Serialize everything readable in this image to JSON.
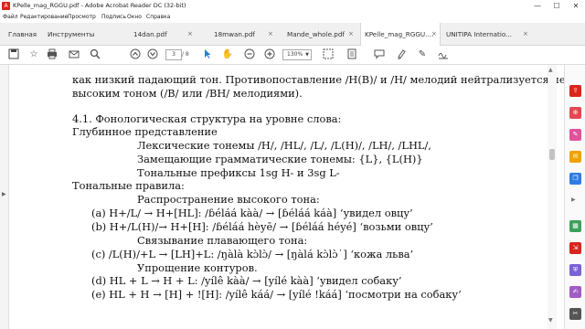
{
  "window": {
    "title": "KPelle_mag_RGGU.pdf - Adobe Acrobat Reader DC (32-bit)",
    "app_icon_glyph": "A",
    "controls": {
      "minimize": "—",
      "maximize": "☐",
      "close": "✕"
    }
  },
  "menu": [
    "Файл",
    "Редактирование",
    "Просмотр",
    "Подпись",
    "Окно",
    "Справка"
  ],
  "tabs": {
    "home": "Главная",
    "tools": "Инструменты",
    "documents": [
      "14dan.pdf",
      "18mwan.pdf",
      "Mande_whole.pdf",
      "KPelle_mag_RGGU....",
      "UNITIPA Internatio..."
    ],
    "active_index": 3,
    "close_glyph": "×"
  },
  "toolbar": {
    "page_current": "3",
    "page_total": "/ 8",
    "zoom": "130%",
    "icons": [
      "save-icon",
      "bookmark-icon",
      "print-icon",
      "email-icon",
      "search-icon",
      "page-up-icon",
      "page-down-icon",
      "select-cursor-icon",
      "hand-icon",
      "zoom-out-icon",
      "zoom-in-icon",
      "marquee-zoom-icon",
      "fit-page-icon",
      "comment-icon",
      "highlight-icon",
      "draw-icon",
      "sign-icon"
    ]
  },
  "document": {
    "lines": [
      "как низкий падающий тон. Противопоставление /H(B)/ и /H/ мелодий нейтрализуется перед",
      "высоким тоном (/B/ или /BH/ мелодиями).",
      "4.1. Фонологическая структура на уровне слова:",
      "Глубинное представление",
      "Лексические тонемы /H/, /HL/, /L/, /L(H)/, /LH/, /LHL/,",
      "Замещающие грамматические тонемы: {L}, {L(H)}",
      "Тональные префиксы 1sg H- и 3sg L-",
      "Тональные правила:",
      "Распространение высокого тона:",
      "(a) H+/L/ → H+[HL]: /ɓéláá kàà/ → [ɓéláá káà] ‘увидел овцу’",
      "(b) H+/L(H)/→ H+[H]: /ɓéláá hèyē/ → [ɓéláá héyé] ‘возьми овцу’",
      "Связывание плавающего тона:",
      "(c) /L(H)/+L → [LH]+L: /ŋàlà kɔ̀lɔ̀/ → [ŋàlá kɔ̀lɔ̀˙] ‘кожа льва’",
      "Упрощение контуров.",
      "(d) HL + L → H + L: /yílê kàà/ → [yílé kàà] ‘увидел собаку’",
      "(e) HL + H → [H] + ![H]: /yílê káá/ → [yílé !káá] ‘посмотри на собаку’"
    ]
  },
  "scrollbar": {
    "up": "▲",
    "down": "▼"
  },
  "left_pane": {
    "expand": "▶"
  },
  "right_rail": {
    "collapse": "▶",
    "tools": [
      {
        "name": "export-pdf-icon",
        "glyph": "⇪",
        "color": "#d9251c"
      },
      {
        "name": "create-pdf-icon",
        "glyph": "⊕",
        "color": "#e34850"
      },
      {
        "name": "edit-pdf-icon",
        "glyph": "✎",
        "color": "#e0529c"
      },
      {
        "name": "comment-tool-icon",
        "glyph": "✉",
        "color": "#f1a100"
      },
      {
        "name": "combine-files-icon",
        "glyph": "❐",
        "color": "#2d7de0"
      },
      {
        "name": "organize-pages-icon",
        "glyph": "▦",
        "color": "#3ba05b"
      },
      {
        "name": "compress-pdf-icon",
        "glyph": "⇲",
        "color": "#d9251c"
      },
      {
        "name": "protect-icon",
        "glyph": "⛨",
        "color": "#7b61d6"
      },
      {
        "name": "fill-sign-icon",
        "glyph": "✍",
        "color": "#a05cc4"
      },
      {
        "name": "more-tools-icon",
        "glyph": "✂",
        "color": "#555555"
      }
    ]
  }
}
